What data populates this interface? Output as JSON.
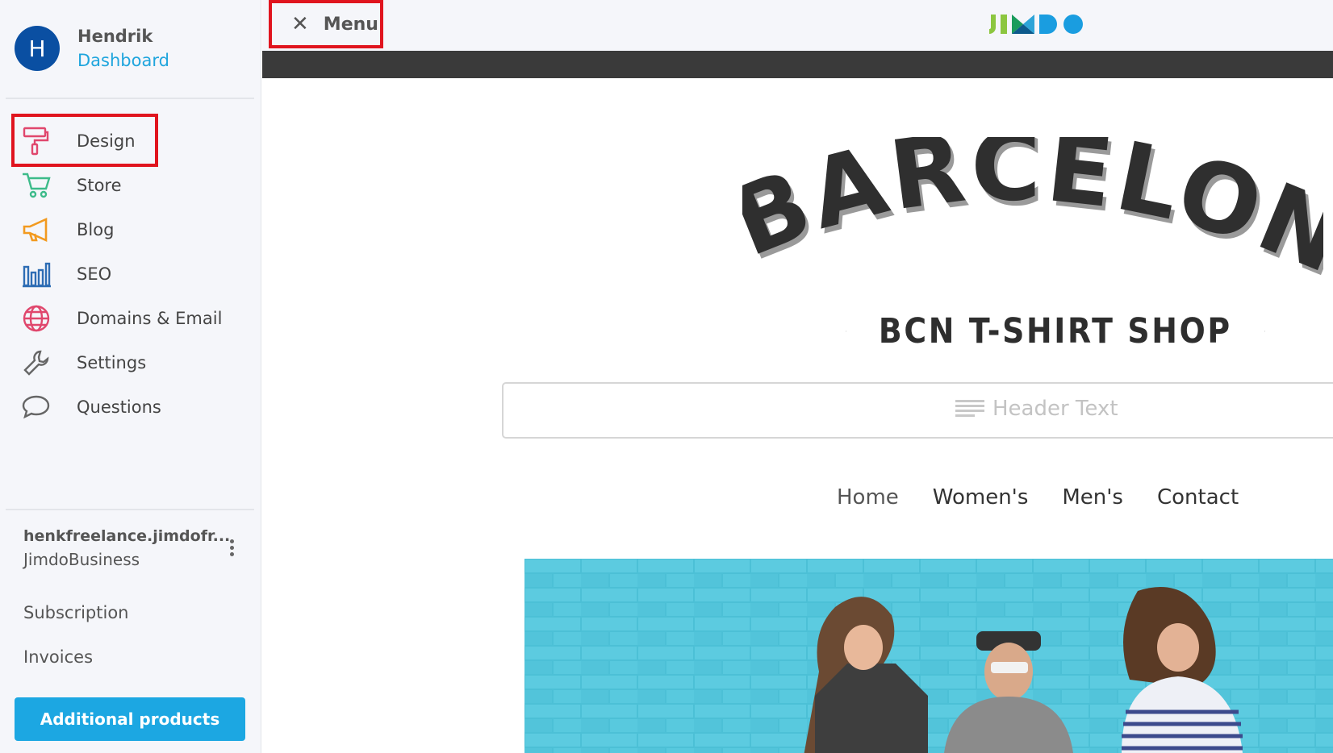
{
  "sidebar": {
    "user": {
      "initial": "H",
      "name": "Hendrik",
      "link": "Dashboard"
    },
    "nav": [
      {
        "label": "Design",
        "icon": "paint-roller-icon",
        "color": "#e0476d"
      },
      {
        "label": "Store",
        "icon": "cart-icon",
        "color": "#3dbb8a"
      },
      {
        "label": "Blog",
        "icon": "megaphone-icon",
        "color": "#f29a1f"
      },
      {
        "label": "SEO",
        "icon": "bar-chart-icon",
        "color": "#2e6db4"
      },
      {
        "label": "Domains & Email",
        "icon": "globe-icon",
        "color": "#e0476d"
      },
      {
        "label": "Settings",
        "icon": "wrench-icon",
        "color": "#666666"
      },
      {
        "label": "Questions",
        "icon": "speech-bubble-icon",
        "color": "#666666"
      }
    ],
    "site": {
      "domain": "henkfreelance.jimdofr...",
      "plan": "JimdoBusiness"
    },
    "links": {
      "subscription": "Subscription",
      "invoices": "Invoices"
    },
    "cta": "Additional products"
  },
  "topbar": {
    "menu_label": "Menu",
    "logo_text": "JIMDO"
  },
  "page": {
    "title": "BARCELONA",
    "subtitle": "BCN T-SHIRT SHOP",
    "header_placeholder": "Header Text",
    "nav": [
      "Home",
      "Women's",
      "Men's",
      "Contact"
    ]
  },
  "colors": {
    "accent": "#1ca7e2",
    "highlight": "#e0141e",
    "avatar": "#0a4fa2",
    "link": "#1fa5dd"
  }
}
